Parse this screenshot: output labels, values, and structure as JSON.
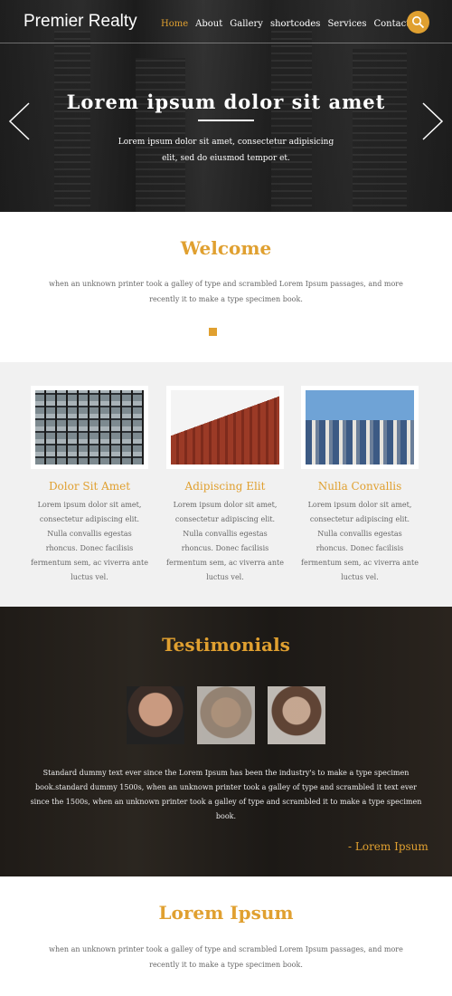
{
  "header": {
    "brand": "Premier Realty",
    "nav": [
      "Home",
      "About",
      "Gallery",
      "shortcodes",
      "Services",
      "Contact"
    ],
    "active_nav": "Home"
  },
  "hero": {
    "title": "Lorem ipsum dolor sit amet",
    "text": "Lorem ipsum dolor sit amet, consectetur adipisicing elit, sed do eiusmod tempor et."
  },
  "welcome": {
    "title": "Welcome",
    "text": "when an unknown printer took a galley of type and scrambled Lorem Ipsum passages, and more recently it to make a type specimen book."
  },
  "features": [
    {
      "title": "Dolor Sit Amet",
      "text": "Lorem ipsum dolor sit amet, consectetur adipiscing elit. Nulla convallis egestas rhoncus. Donec facilisis fermentum sem, ac viverra ante luctus vel."
    },
    {
      "title": "Adipiscing Elit",
      "text": "Lorem ipsum dolor sit amet, consectetur adipiscing elit. Nulla convallis egestas rhoncus. Donec facilisis fermentum sem, ac viverra ante luctus vel."
    },
    {
      "title": "Nulla Convallis",
      "text": "Lorem ipsum dolor sit amet, consectetur adipiscing elit. Nulla convallis egestas rhoncus. Donec facilisis fermentum sem, ac viverra ante luctus vel."
    }
  ],
  "testimonials": {
    "title": "Testimonials",
    "text": "Standard dummy text ever since the Lorem Ipsum has been the industry's to make a type specimen book.standard dummy 1500s, when an unknown printer took a galley of type and scrambled it text ever since the 1500s, when an unknown printer took a galley of type and scrambled it to make a type specimen book.",
    "author": "- Lorem Ipsum"
  },
  "lorem": {
    "title": "Lorem Ipsum",
    "text": "when an unknown printer took a galley of type and scrambled Lorem Ipsum passages, and more recently it to make a type specimen book."
  },
  "colors": {
    "accent": "#e0a030",
    "text": "#666666",
    "section_gray": "#f1f1f1"
  },
  "icons": {
    "search": "search-icon",
    "prev": "chevron-left-icon",
    "next": "chevron-right-icon"
  }
}
